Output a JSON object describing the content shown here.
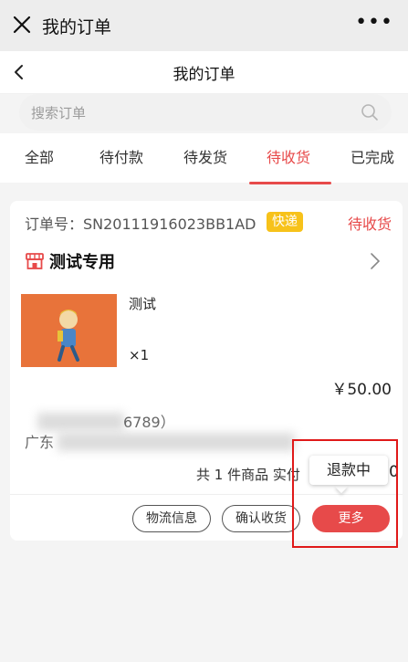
{
  "topbar": {
    "title": "我的订单",
    "more": "•••"
  },
  "navbar": {
    "title": "我的订单"
  },
  "search": {
    "placeholder": "搜索订单"
  },
  "tabs": [
    {
      "label": "全部"
    },
    {
      "label": "待付款"
    },
    {
      "label": "待发货"
    },
    {
      "label": "待收货",
      "active": true
    },
    {
      "label": "已完成"
    }
  ],
  "order": {
    "number": "订单号：SN20111916023BB1AD",
    "delivery_badge": "快递",
    "status": "待收货",
    "store_name": "测试专用",
    "product": {
      "name": "测试",
      "quantity": "×1",
      "price": "￥50.00"
    },
    "address_line1": "6789）",
    "address_line2": "广东",
    "total_label": "共 1 件商品  实付",
    "total_value": "0",
    "buttons": {
      "logistics": "物流信息",
      "confirm": "确认收货",
      "more": "更多"
    },
    "popup": "退款中"
  },
  "colors": {
    "accent": "#e74a4a",
    "badge": "#f7c21a",
    "thumb_bg": "#e8733a"
  }
}
